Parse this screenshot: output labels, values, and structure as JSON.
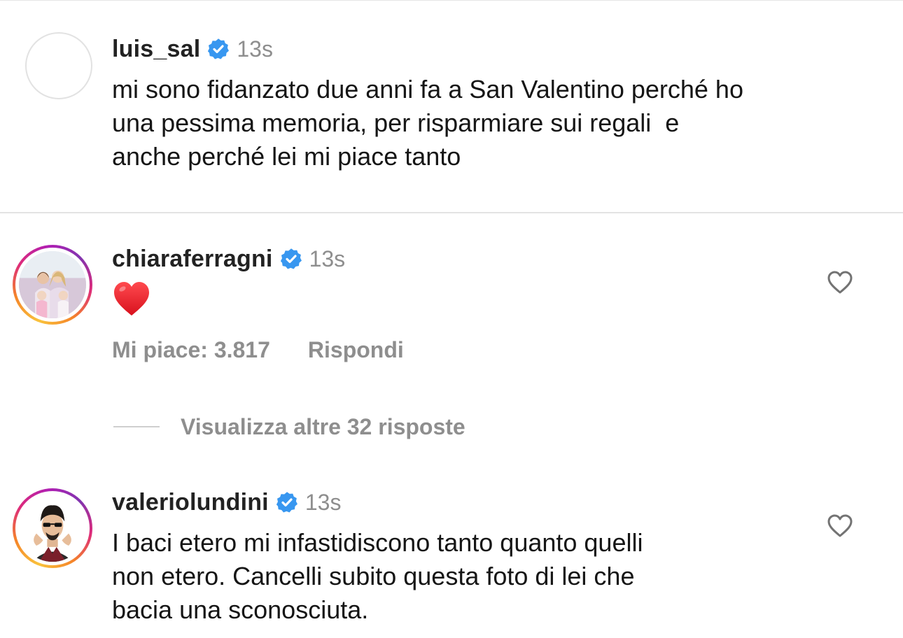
{
  "comments": [
    {
      "username": "luis_sal",
      "time": "13s",
      "text": "mi sono fidanzato due anni fa a San Valentino perché ho\nuna pessima memoria, per risparmiare sui regali  e\nanche perché lei mi piace tanto"
    },
    {
      "username": "chiaraferragni",
      "time": "13s",
      "text_emoji": "heart-red",
      "likes_label": "Mi piace: 3.817",
      "reply_label": "Rispondi",
      "view_replies_label": "Visualizza altre 32 risposte"
    },
    {
      "username": "valeriolundini",
      "time": "13s",
      "text": "I baci etero mi infastidiscono tanto quanto quelli\nnon etero. Cancelli subito questa foto di lei che\nbacia una sconosciuta."
    }
  ],
  "icons": {
    "verified": "verified-badge-icon",
    "like": "heart-outline-icon"
  },
  "colors": {
    "verified_blue": "#3897f0",
    "secondary_text": "#8e8e8e",
    "emoji_red": "#e0242e"
  }
}
